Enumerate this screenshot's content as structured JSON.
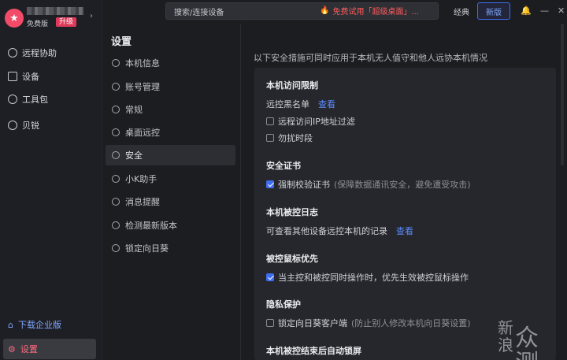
{
  "profile": {
    "plan": "免费版",
    "upgrade": "升级"
  },
  "nav": {
    "items": [
      {
        "label": "远程协助"
      },
      {
        "label": "设备"
      },
      {
        "label": "工具包"
      },
      {
        "label": "贝锐"
      }
    ],
    "download": "下载企业版",
    "settings": "设置"
  },
  "header": {
    "search_placeholder": "搜索/连接设备",
    "promo": "免费试用「超级桌面」...",
    "mode_classic": "经典",
    "mode_new": "新版"
  },
  "settings_nav": {
    "title": "设置",
    "items": [
      {
        "label": "本机信息"
      },
      {
        "label": "账号管理"
      },
      {
        "label": "常规"
      },
      {
        "label": "桌面远控"
      },
      {
        "label": "安全"
      },
      {
        "label": "小K助手"
      },
      {
        "label": "消息提醒"
      },
      {
        "label": "检测最新版本"
      },
      {
        "label": "锁定向日葵"
      }
    ]
  },
  "content": {
    "intro": "以下安全措施可同时应用于本机无人值守和他人远协本机情况",
    "access": {
      "title": "本机访问限制",
      "blacklist": "远控黑名单",
      "blacklist_link": "查看",
      "ip_filter": "远程访问IP地址过滤",
      "dnd": "勿扰时段"
    },
    "cert": {
      "title": "安全证书",
      "option": "强制校验证书",
      "note": "(保障数据通讯安全，避免遭受攻击)"
    },
    "log": {
      "title": "本机被控日志",
      "text": "可查看其他设备远控本机的记录",
      "link": "查看"
    },
    "mouse": {
      "title": "被控鼠标优先",
      "option": "当主控和被控同时操作时，优先生效被控鼠标操作"
    },
    "privacy": {
      "title": "隐私保护",
      "option": "锁定向日葵客户端",
      "note": "(防止别人修改本机向日葵设置)"
    },
    "autolock": {
      "title": "本机被控结束后自动锁屏"
    }
  },
  "watermark": {
    "line1": "新",
    "line2": "浪",
    "brand": "众测"
  }
}
